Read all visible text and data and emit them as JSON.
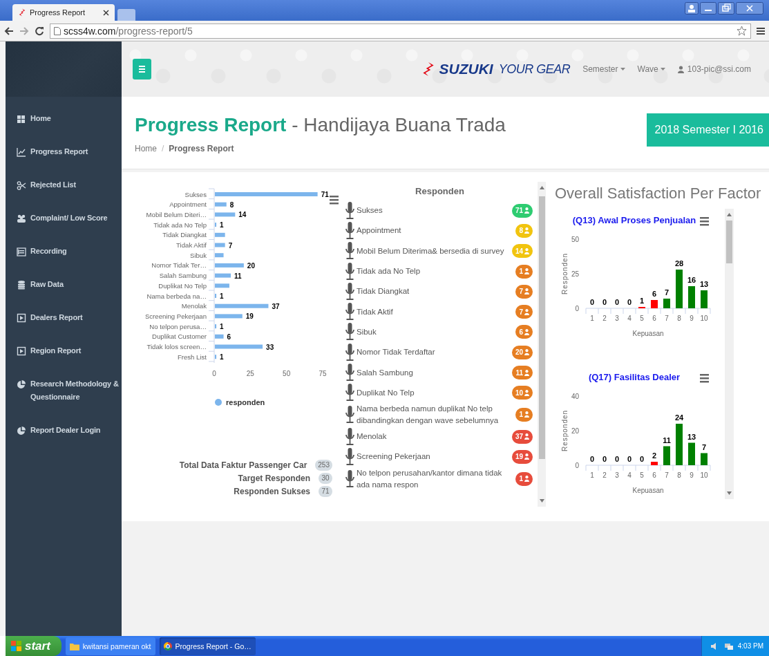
{
  "browser": {
    "tab_title": "Progress Report",
    "address": {
      "host": "scss4w.com",
      "path": "/progress-report/5"
    }
  },
  "header": {
    "brand": "SUZUKI",
    "tagline": "YOUR GEAR",
    "menus": [
      "Semester",
      "Wave"
    ],
    "user": "103-pic@ssi.com"
  },
  "sidebar": {
    "items": [
      {
        "label": "Home"
      },
      {
        "label": "Progress Report"
      },
      {
        "label": "Rejected List"
      },
      {
        "label": "Complaint/ Low Score"
      },
      {
        "label": "Recording"
      },
      {
        "label": "Raw Data"
      },
      {
        "label": "Dealers Report"
      },
      {
        "label": "Region Report"
      },
      {
        "label": "Research Methodology & Questionnaire"
      },
      {
        "label": "Report Dealer Login"
      }
    ]
  },
  "page": {
    "title": "Progress Report",
    "subtitle": "- Handijaya Buana Trada",
    "breadcrumb": [
      "Home",
      "Progress Report"
    ],
    "breadcrumb_separator": "/",
    "period_button": "2018 Semester I 2016"
  },
  "status_chart": {
    "chart_data": {
      "type": "bar",
      "orientation": "horizontal",
      "categories": [
        "Sukses",
        "Appointment",
        "Mobil Belum Diteri…",
        "Tidak ada No Telp",
        "Tidak Diangkat",
        "Tidak Aktif",
        "Sibuk",
        "Nomor Tidak Ter…",
        "Salah Sambung",
        "Duplikat No Telp",
        "Nama berbeda na…",
        "Menolak",
        "Screening Pekerjaan",
        "No telpon perusa…",
        "Duplikat Customer",
        "Tidak lolos screen…",
        "Fresh List"
      ],
      "series": [
        {
          "name": "responden",
          "color": "#7cb5ec",
          "values": [
            71,
            8,
            14,
            1,
            7,
            7,
            6,
            20,
            11,
            10,
            1,
            37,
            19,
            1,
            6,
            33,
            1
          ]
        }
      ],
      "value_labels": [
        "71",
        "8",
        "14",
        "1",
        null,
        "7",
        null,
        "20",
        "11",
        null,
        "1",
        "37",
        "19",
        "1",
        "6",
        "33",
        "1"
      ],
      "xlim": [
        0,
        75
      ],
      "xticks": [
        0,
        25,
        50,
        75
      ]
    }
  },
  "totals": [
    {
      "label": "Total Data Faktur Passenger Car",
      "value": "253"
    },
    {
      "label": "Target Responden",
      "value": "30"
    },
    {
      "label": "Responden Sukses",
      "value": "71"
    }
  ],
  "responden_list": {
    "title": "Responden",
    "items": [
      {
        "label": "Sukses",
        "count": "71",
        "color": "#2ecc71"
      },
      {
        "label": "Appointment",
        "count": "8",
        "color": "#f1c40f"
      },
      {
        "label": "Mobil Belum Diterima& bersedia di survey",
        "count": "14",
        "color": "#f1c40f"
      },
      {
        "label": "Tidak ada No Telp",
        "count": "1",
        "color": "#e67e22"
      },
      {
        "label": "Tidak Diangkat",
        "count": "7",
        "color": "#e67e22"
      },
      {
        "label": "Tidak Aktif",
        "count": "7",
        "color": "#e67e22"
      },
      {
        "label": "Sibuk",
        "count": "6",
        "color": "#e67e22"
      },
      {
        "label": "Nomor Tidak Terdaftar",
        "count": "20",
        "color": "#e67e22"
      },
      {
        "label": "Salah Sambung",
        "count": "11",
        "color": "#e67e22"
      },
      {
        "label": "Duplikat No Telp",
        "count": "10",
        "color": "#e67e22"
      },
      {
        "label": "Nama berbeda namun duplikat No telp dibandingkan dengan wave sebelumnya",
        "count": "1",
        "color": "#e67e22"
      },
      {
        "label": "Menolak",
        "count": "37",
        "color": "#e74c3c"
      },
      {
        "label": "Screening Pekerjaan",
        "count": "19",
        "color": "#e74c3c"
      },
      {
        "label": "No telpon perusahan/kantor dimana tidak ada nama respon",
        "count": "1",
        "color": "#e74c3c"
      }
    ]
  },
  "satisfaction": {
    "title": "Overall Satisfaction Per Factor",
    "charts": [
      {
        "chart_data": {
          "type": "bar",
          "title": "(Q13) Awal Proses Penjualan",
          "xlabel": "Kepuasan",
          "ylabel": "Responden",
          "categories": [
            "1",
            "2",
            "3",
            "4",
            "5",
            "6",
            "7",
            "8",
            "9",
            "10"
          ],
          "series": [
            {
              "colors": [
                null,
                null,
                null,
                null,
                "#ff0000",
                "#ff0000",
                "#008000",
                "#008000",
                "#008000",
                "#008000"
              ],
              "values": [
                0,
                0,
                0,
                0,
                1,
                6,
                7,
                28,
                16,
                13
              ]
            }
          ],
          "ylim": [
            0,
            50
          ],
          "yticks": [
            0,
            25,
            50
          ],
          "data_labels": true
        }
      },
      {
        "chart_data": {
          "type": "bar",
          "title": "(Q17) Fasilitas Dealer",
          "xlabel": "Kepuasan",
          "ylabel": "Responden",
          "categories": [
            "1",
            "2",
            "3",
            "4",
            "5",
            "6",
            "7",
            "8",
            "9",
            "10"
          ],
          "series": [
            {
              "colors": [
                null,
                null,
                null,
                null,
                null,
                "#ff0000",
                "#008000",
                "#008000",
                "#008000",
                "#008000"
              ],
              "values": [
                0,
                0,
                0,
                0,
                0,
                2,
                11,
                24,
                13,
                7
              ]
            }
          ],
          "ylim": [
            0,
            40
          ],
          "yticks": [
            0,
            20,
            40
          ],
          "data_labels": true
        }
      }
    ]
  },
  "taskbar": {
    "start": "start",
    "tasks": [
      {
        "label": "kwitansi pameran okt",
        "selected": false
      },
      {
        "label": "Progress Report - Go…",
        "selected": true
      }
    ],
    "clock": "4:03 PM"
  }
}
